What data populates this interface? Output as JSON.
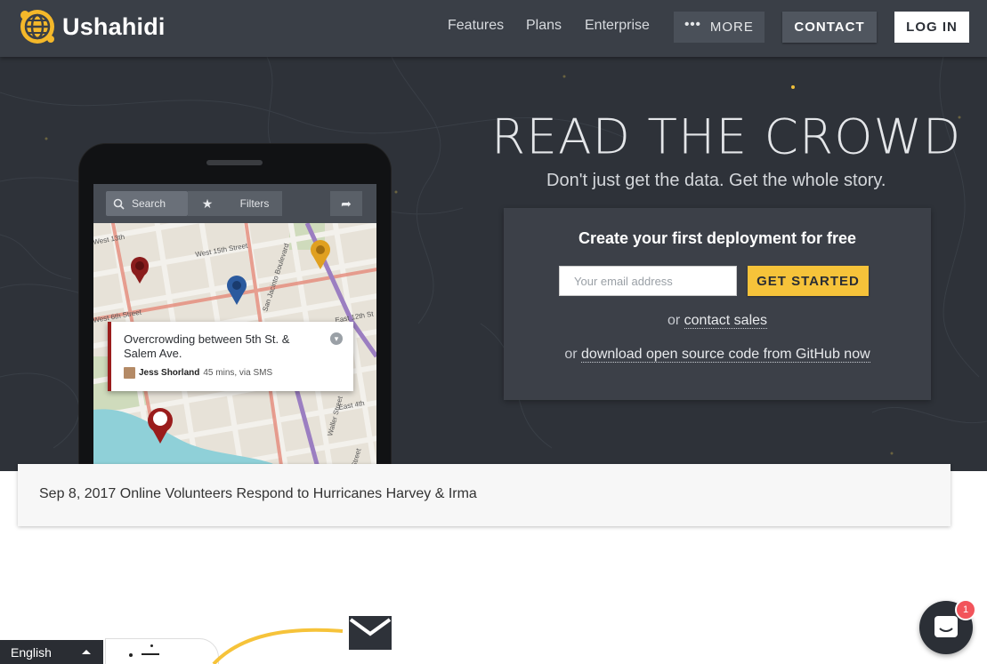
{
  "header": {
    "logo_text": "Ushahidi",
    "nav": {
      "features": "Features",
      "plans": "Plans",
      "enterprise": "Enterprise",
      "more": "MORE",
      "more_dots": "•••",
      "contact": "CONTACT",
      "login": "LOG IN"
    }
  },
  "hero": {
    "title": "READ THE CROWD",
    "subtitle": "Don't just get the data. Get the whole story.",
    "cta": {
      "heading": "Create your first deployment for free",
      "email_placeholder": "Your email address",
      "email_value": "",
      "button": "GET STARTED",
      "or1_prefix": "or",
      "or1_link": "contact sales",
      "or2_prefix": "or",
      "or2_link": "download open source code from GitHub now"
    }
  },
  "phone_app": {
    "search": "Search",
    "star": "★",
    "filters": "Filters",
    "share": "➦",
    "streets": {
      "west15": "West 15th Street",
      "west13": "West 13th",
      "sanjacinto": "San Jacinto Boulevard",
      "east12": "East 12th St",
      "west6": "West 6th Street",
      "east4": "East 4th",
      "waller": "Waller Street",
      "street": "Street"
    },
    "popup": {
      "title": "Overcrowding between 5th St. & Salem Ave.",
      "author": "Jess Shorland",
      "meta": "45 mins, via SMS"
    }
  },
  "news": {
    "text": "Sep 8, 2017 Online Volunteers Respond to Hurricanes Harvey & Irma"
  },
  "footer": {
    "language": "English",
    "chat_badge_count": "1"
  },
  "colors": {
    "header_bg": "#3a3f47",
    "hero_bg": "#2e3239",
    "accent_yellow": "#f6c33a",
    "pin_red": "#9a1c1c",
    "pin_blue": "#2b5a9e",
    "pin_orange": "#e0a020",
    "badge_red": "#f2545b"
  },
  "icons": {
    "logo": "globe-logo-icon",
    "search": "search-icon",
    "star": "star-icon",
    "share": "share-arrow-icon",
    "chevron": "chevron-down-icon",
    "envelope": "envelope-icon",
    "chat": "chat-icon",
    "caret": "caret-up-icon"
  }
}
